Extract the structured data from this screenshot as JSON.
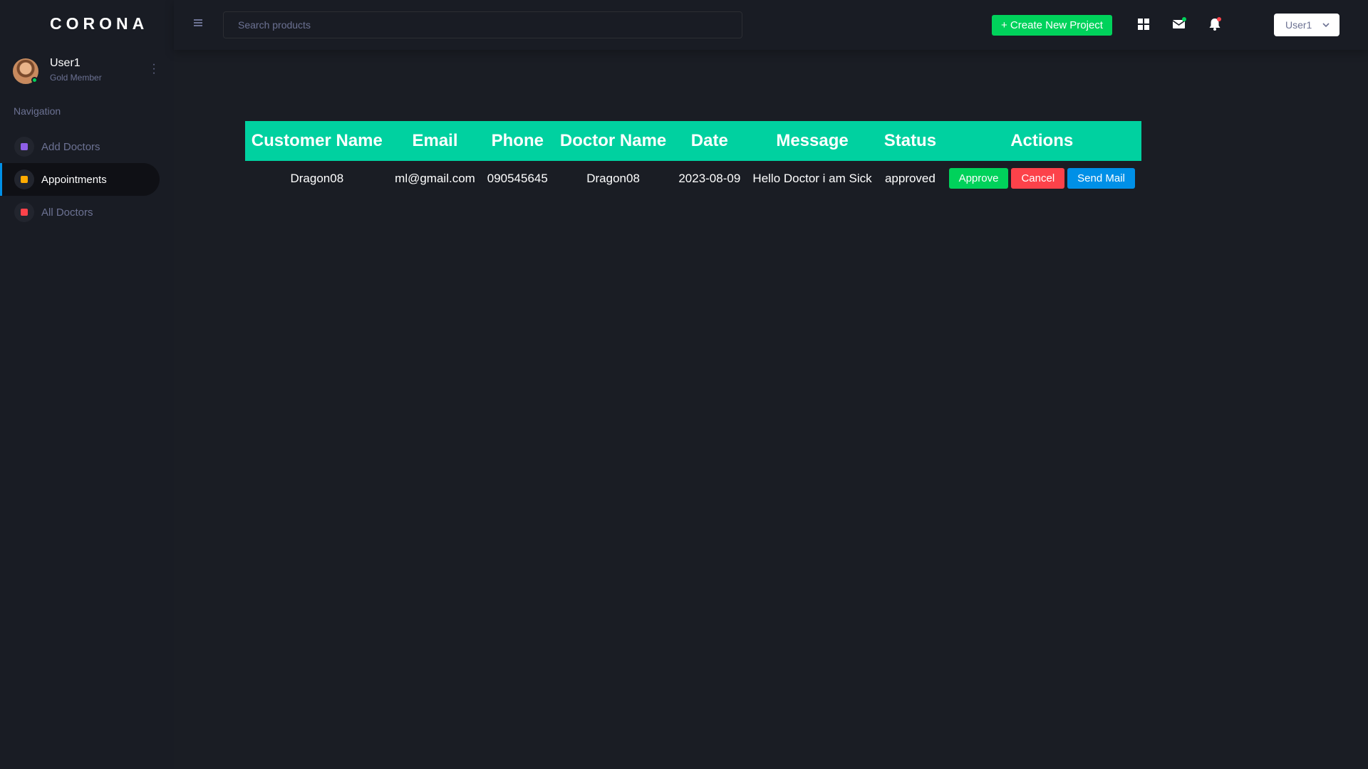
{
  "brand": "CORONA",
  "profile": {
    "name": "User1",
    "role": "Gold Member"
  },
  "nav": {
    "title": "Navigation",
    "items": [
      {
        "label": "Add Doctors",
        "icon_color": "#8f5fe8",
        "active": false
      },
      {
        "label": "Appointments",
        "icon_color": "#ffab00",
        "active": true
      },
      {
        "label": "All Doctors",
        "icon_color": "#fc424a",
        "active": false
      }
    ]
  },
  "topbar": {
    "search_placeholder": "Search products",
    "create_label": "+ Create New Project",
    "user_label": "User1"
  },
  "table": {
    "headers": [
      "Customer Name",
      "Email",
      "Phone",
      "Doctor Name",
      "Date",
      "Message",
      "Status",
      "Actions"
    ],
    "rows": [
      {
        "customer": "Dragon08",
        "email": "ml@gmail.com",
        "phone": "090545645",
        "doctor": "Dragon08",
        "date": "2023-08-09",
        "message": "Hello Doctor i am Sick",
        "status": "approved"
      }
    ],
    "actions": {
      "approve": "Approve",
      "cancel": "Cancel",
      "send_mail": "Send Mail"
    }
  },
  "colors": {
    "header_bg": "#00d1a0",
    "success": "#00d25b",
    "danger": "#fc424a",
    "primary": "#0090e7"
  }
}
